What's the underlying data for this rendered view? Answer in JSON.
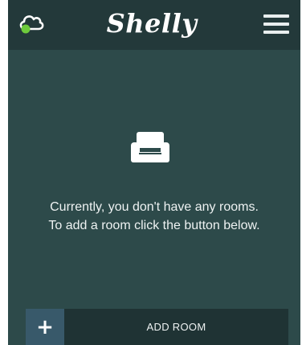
{
  "app": {
    "brand": "Shelly",
    "icons": {
      "cloud": "cloud-status-icon",
      "menu": "hamburger-menu-icon",
      "empty_state": "sofa-icon",
      "add": "plus-icon"
    },
    "colors": {
      "background": "#2d4a4a",
      "topbar": "#23393a",
      "add_bar": "#1f3334",
      "plus_box": "#38596a",
      "cloud_status": "#6ecb3c"
    }
  },
  "empty_state": {
    "message_line1": "Currently, you don't have any rooms.",
    "message_line2": "To add a room click the button below."
  },
  "add_room": {
    "plus_label": "+",
    "button_label": "ADD ROOM"
  }
}
